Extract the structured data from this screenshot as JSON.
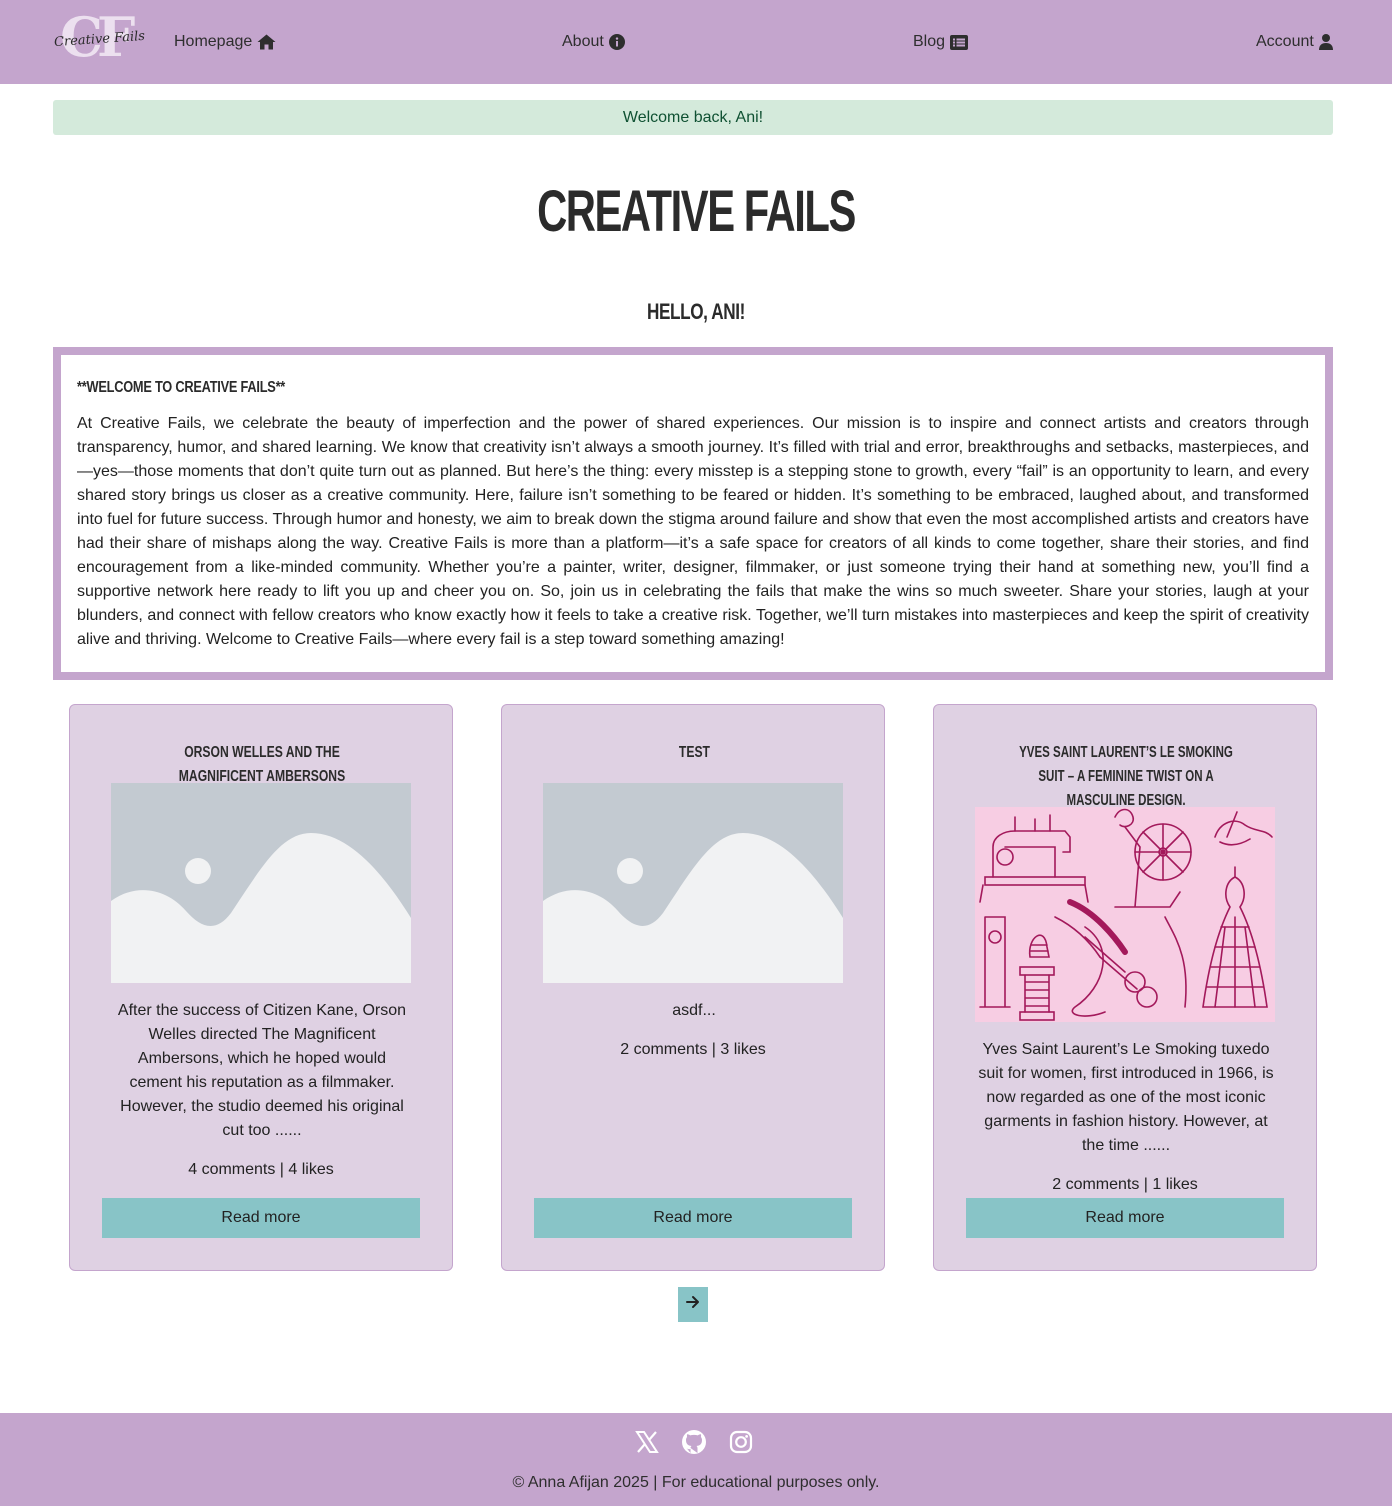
{
  "nav": {
    "logo": {
      "monogram": "CF",
      "script": "Creative Fails",
      "icon": "logo"
    },
    "links": [
      {
        "label": "Homepage",
        "icon": "home-icon"
      },
      {
        "label": "About",
        "icon": "info-circle-icon"
      },
      {
        "label": "Blog",
        "icon": "list-icon"
      },
      {
        "label": "Account",
        "icon": "user-icon"
      }
    ]
  },
  "alert": {
    "message": "Welcome back, Ani!"
  },
  "page": {
    "title": "Creative Fails",
    "greeting": "Hello, Ani!"
  },
  "intro": {
    "heading": "**Welcome to Creative Fails**",
    "body": "At Creative Fails, we celebrate the beauty of imperfection and the power of shared experiences. Our mission is to inspire and connect artists and creators through transparency, humor, and shared learning. We know that creativity isn’t always a smooth journey. It’s filled with trial and error, breakthroughs and setbacks, masterpieces, and—yes—those moments that don’t quite turn out as planned. But here’s the thing: every misstep is a stepping stone to growth, every “fail” is an opportunity to learn, and every shared story brings us closer as a creative community. Here, failure isn’t something to be feared or hidden. It’s something to be embraced, laughed about, and transformed into fuel for future success. Through humor and honesty, we aim to break down the stigma around failure and show that even the most accomplished artists and creators have had their share of mishaps along the way. Creative Fails is more than a platform—it’s a safe space for creators of all kinds to come together, share their stories, and find encouragement from a like-minded community. Whether you’re a painter, writer, designer, filmmaker, or just someone trying their hand at something new, you’ll find a supportive network here ready to lift you up and cheer you on. So, join us in celebrating the fails that make the wins so much sweeter. Share your stories, laugh at your blunders, and connect with fellow creators who know exactly how it feels to take a creative risk. Together, we’ll turn mistakes into masterpieces and keep the spirit of creativity alive and thriving. Welcome to Creative Fails—where every fail is a step toward something amazing!"
  },
  "posts": [
    {
      "title": "Orson Welles and The Magnificent Ambersons",
      "image": "placeholder-image",
      "excerpt": "After the success of Citizen Kane, Orson Welles directed The Magnificent Ambersons, which he hoped would cement his reputation as a filmmaker. However, the studio deemed his original cut too ......",
      "meta": "4 comments | 4 likes",
      "button": "Read more"
    },
    {
      "title": "Test",
      "image": "placeholder-image",
      "excerpt": "asdf...",
      "meta": "2 comments | 3 likes",
      "button": "Read more"
    },
    {
      "title": "Yves Saint Laurent’s Le Smoking Suit – A Feminine Twist on a Masculine Design.",
      "image": "sewing-illustration",
      "excerpt": "Yves Saint Laurent’s Le Smoking tuxedo suit for women, first introduced in 1966, is now regarded as one of the most iconic garments in fashion history. However, at the time ......",
      "meta": "2 comments | 1 likes",
      "button": "Read more"
    }
  ],
  "pagination": {
    "next_icon": "arrow-right-icon"
  },
  "footer": {
    "social": [
      {
        "icon": "x-twitter-icon"
      },
      {
        "icon": "github-icon"
      },
      {
        "icon": "instagram-icon"
      }
    ],
    "copyright": "© Anna Afijan 2025 | For educational purposes only."
  },
  "colors": {
    "brand_purple": "#c4a5cd",
    "card_bg": "#dfd1e3",
    "button_teal": "#88c4c7",
    "alert_bg": "#d4eadb",
    "alert_text": "#0f5132",
    "illustration_pink": "#f7cde3",
    "illustration_ink": "#a3195b"
  }
}
